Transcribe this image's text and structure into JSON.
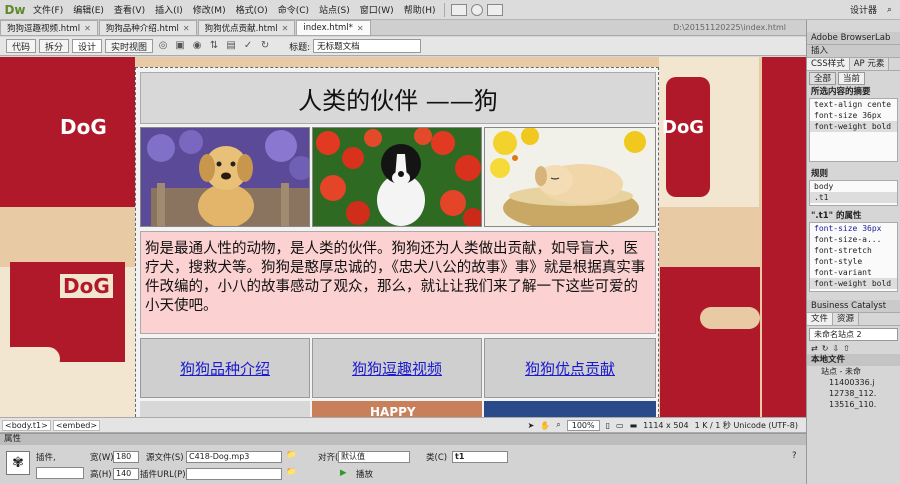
{
  "app": {
    "logo": "Dw",
    "workspace": "设计器"
  },
  "menu": [
    "文件(F)",
    "编辑(E)",
    "查看(V)",
    "插入(I)",
    "修改(M)",
    "格式(O)",
    "命令(C)",
    "站点(S)",
    "窗口(W)",
    "帮助(H)"
  ],
  "doc_tabs": [
    {
      "label": "狗狗逗趣视频.html",
      "active": false
    },
    {
      "label": "狗狗品种介绍.html",
      "active": false
    },
    {
      "label": "狗狗优点贡献.html",
      "active": false
    },
    {
      "label": "index.html*",
      "active": true
    }
  ],
  "doc_path": "D:\\20151120225\\index.html",
  "doc_toolbar": {
    "views": [
      "代码",
      "拆分",
      "设计",
      "实时视图"
    ],
    "active_view": "设计",
    "title_label": "标题:",
    "title_value": "无标题文档"
  },
  "page": {
    "heading": "人类的伙伴 ——狗",
    "intro": "狗是最通人性的动物，是人类的伙伴。狗狗还为人类做出贡献，如导盲犬，医疗犬，搜救犬等。狗狗是憨厚忠诚的，《忠犬八公的故事》事》就是根据真实事件改编的，小八的故事感动了观众，那么，就让让我们来了解一下这些可爱的小天使吧。",
    "links": [
      "狗狗品种介绍",
      "狗狗逗趣视频",
      "狗狗优点贡献"
    ],
    "dog_word": "DoG",
    "happy_text": "HAPPY"
  },
  "statusbar": {
    "tags": [
      "<body.t1>",
      "<embed>"
    ],
    "zoom": "100%",
    "size": "1114 x 504",
    "info": "1 K / 1 秒  Unicode (UTF-8)"
  },
  "properties": {
    "title": "属性",
    "plugin_label": "插件,",
    "width_label": "宽(W)",
    "width_value": "180",
    "height_label": "高(H)",
    "height_value": "140",
    "src_label": "源文件(S)",
    "src_value": "C418-Dog.mp3",
    "plugin_url_label": "插件URL(P)",
    "align_label": "对齐(A)",
    "align_value": "默认值",
    "class_label": "类(C)",
    "class_value": "t1",
    "play_label": "播放"
  },
  "right_panel": {
    "browserlab": "Adobe BrowserLab",
    "insert": "插入",
    "css_tabs": [
      "CSS样式",
      "AP 元素"
    ],
    "mode_tabs": [
      "全部",
      "当前"
    ],
    "summary_title": "所选内容的摘要",
    "summary_rows": [
      {
        "prop": "text-align",
        "val": "cente"
      },
      {
        "prop": "font-size",
        "val": "36px"
      },
      {
        "prop": "font-weight",
        "val": "bold"
      }
    ],
    "rules_title": "规则",
    "rules": [
      "body",
      ".t1"
    ],
    "props_title": "\".t1\" 的属性",
    "prop_list": [
      {
        "prop": "font-size",
        "val": "36px"
      },
      {
        "prop": "font-size-a...",
        "val": ""
      },
      {
        "prop": "font-stretch",
        "val": ""
      },
      {
        "prop": "font-style",
        "val": ""
      },
      {
        "prop": "font-variant",
        "val": ""
      },
      {
        "prop": "font-weight",
        "val": "bold"
      }
    ],
    "business_catalyst": "Business Catalyst",
    "file_tabs": [
      "文件",
      "资源"
    ],
    "site_select": "未命名站点 2",
    "local_files": "本地文件",
    "site_root": "站点 - 未命",
    "files": [
      "11400336.j",
      "12738_112.",
      "13516_110."
    ]
  },
  "colors": {
    "dog_red": "#b0192a",
    "tan": "#e8cba4",
    "intro_pink": "#fbd1d1",
    "link_blue": "#1a1ad0"
  }
}
